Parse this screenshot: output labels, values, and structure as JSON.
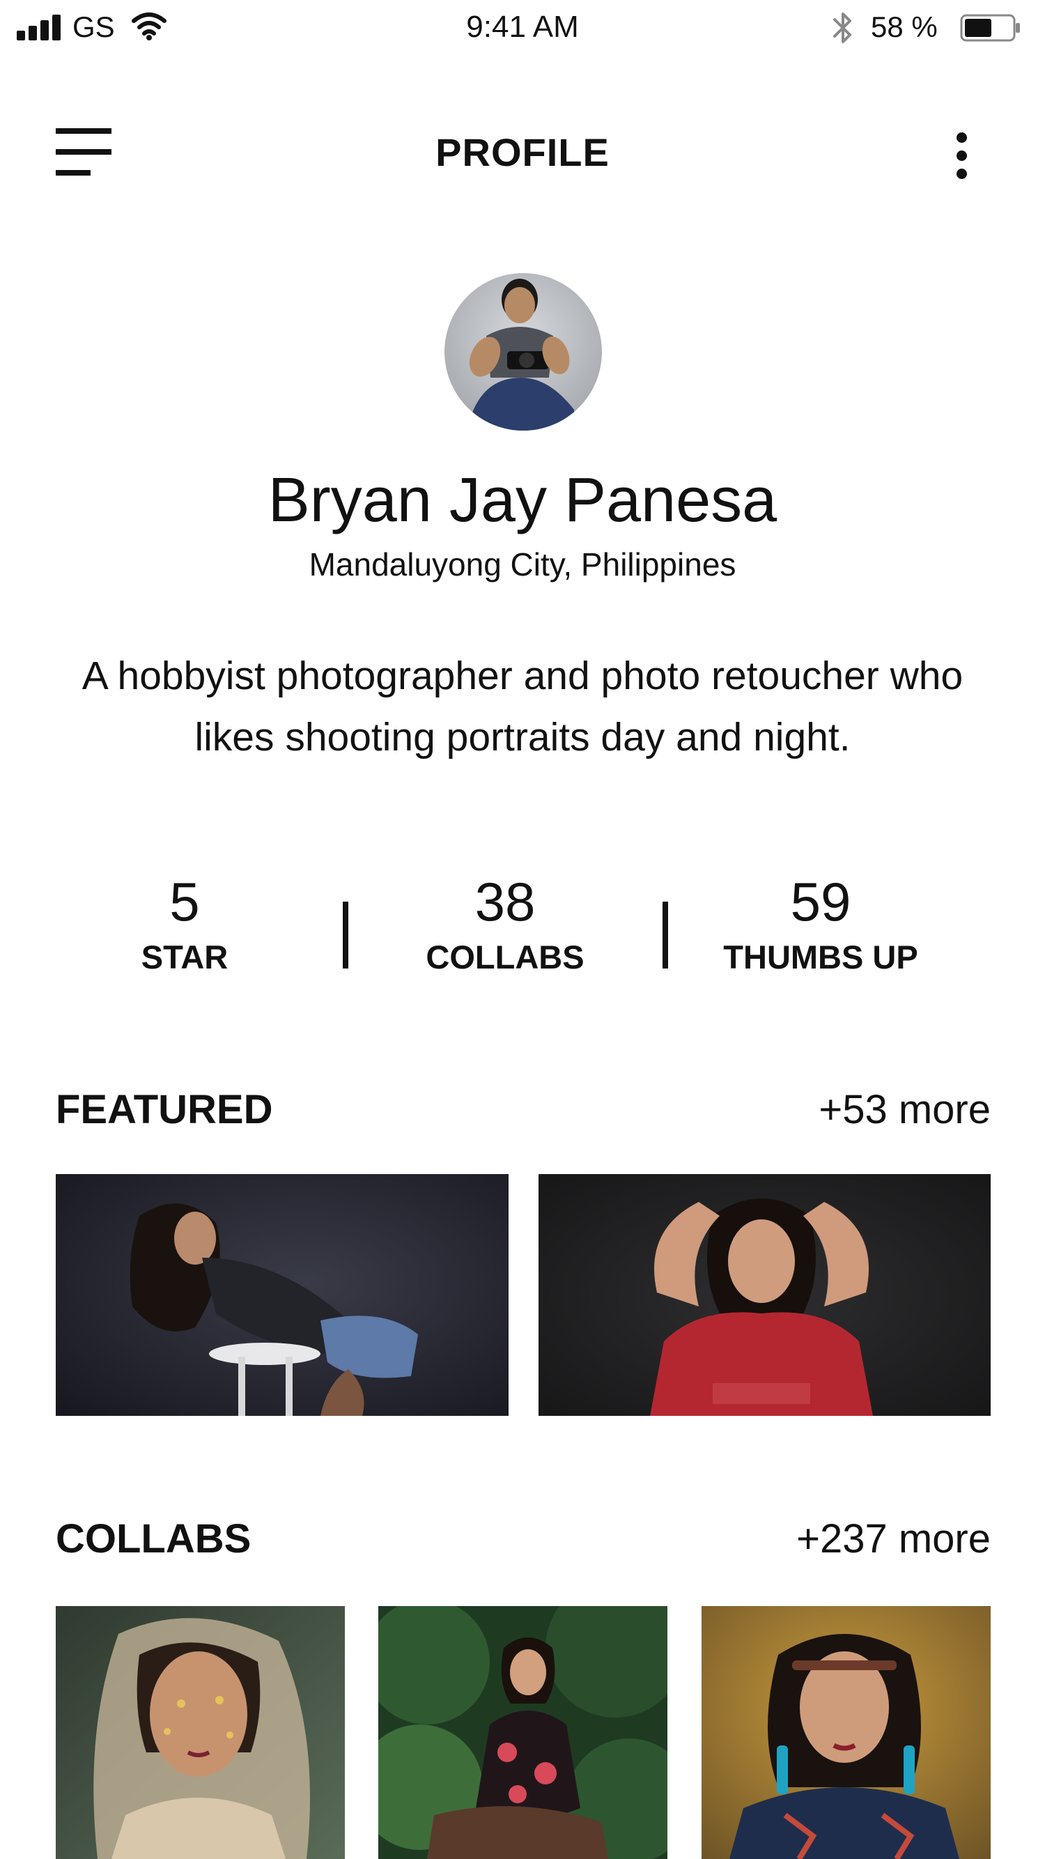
{
  "status_bar": {
    "carrier": "GS",
    "time": "9:41 AM",
    "battery_percent": "58 %",
    "battery_level": 0.58,
    "icons": [
      "signal-icon",
      "wifi-icon",
      "bluetooth-icon",
      "battery-icon"
    ]
  },
  "header": {
    "title": "PROFILE",
    "menu_icon": "hamburger-menu-icon",
    "more_icon": "more-vertical-icon"
  },
  "profile": {
    "name": "Bryan Jay Panesa",
    "location": "Mandaluyong City, Philippines",
    "bio": "A hobbyist photographer and photo retoucher who likes shooting portraits day and night."
  },
  "stats": [
    {
      "value": "5",
      "label": "STAR"
    },
    {
      "value": "38",
      "label": "COLLABS"
    },
    {
      "value": "59",
      "label": "THUMBS UP"
    }
  ],
  "featured": {
    "title": "FEATURED",
    "more": "+53 more"
  },
  "collabs": {
    "title": "COLLABS",
    "more": "+237 more"
  },
  "colors": {
    "text": "#111111",
    "background": "#ffffff"
  }
}
